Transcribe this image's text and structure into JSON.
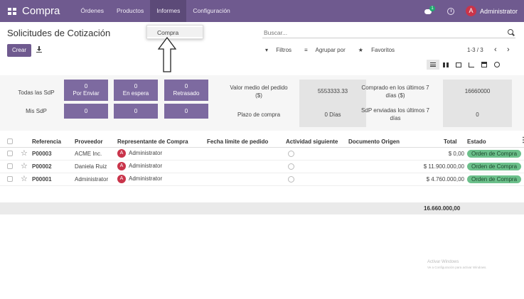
{
  "navbar": {
    "brand": "Compra",
    "menu": [
      "Órdenes",
      "Productos",
      "Informes",
      "Configuración"
    ],
    "chat_badge": "1",
    "user": {
      "initial": "A",
      "name": "Administrator"
    }
  },
  "dropdown": {
    "items": [
      "Compra"
    ]
  },
  "control": {
    "title": "Solicitudes de Cotización",
    "create_label": "Crear",
    "search_placeholder": "Buscar...",
    "filters_label": "Filtros",
    "groupby_label": "Agrupar por",
    "favorites_label": "Favoritos",
    "pager": "1-3 / 3"
  },
  "dashboard": {
    "all_label": "Todas las SdP",
    "my_label": "Mis SdP",
    "tiles_all": [
      {
        "value": "0",
        "label": "Por Enviar"
      },
      {
        "value": "0",
        "label": "En espera"
      },
      {
        "value": "0",
        "label": "Retrasado"
      }
    ],
    "tiles_my": [
      "0",
      "0",
      "0"
    ],
    "avg_label": "Valor medio del pedido ($)",
    "avg_value": "5553333.33",
    "lead_label": "Plazo de compra",
    "lead_value": "0  Días",
    "bought_label": "Comprado en los últimos 7 días ($)",
    "bought_value": "16660000",
    "sent_label": "SdP enviadas los últimos 7 días",
    "sent_value": "0"
  },
  "table": {
    "headers": [
      "Referencia",
      "Proveedor",
      "Representante de Compra",
      "Fecha límite de pedido",
      "Actividad siguiente",
      "Documento Origen",
      "Total",
      "Estado"
    ],
    "rows": [
      {
        "ref": "P00003",
        "vendor": "ACME Inc.",
        "rep": "Administrator",
        "total": "$ 0,00",
        "status": "Orden de Compra"
      },
      {
        "ref": "P00002",
        "vendor": "Daniela Ruiz",
        "rep": "Administrator",
        "total": "$ 11.900.000,00",
        "status": "Orden de Compra"
      },
      {
        "ref": "P00001",
        "vendor": "Administrator",
        "rep": "Administrator",
        "total": "$ 4.760.000,00",
        "status": "Orden de Compra"
      }
    ],
    "grand_total": "16.660.000,00"
  },
  "watermark": {
    "title": "Activar Windows",
    "subtitle": "Ve a Configuración para activar Windows."
  }
}
